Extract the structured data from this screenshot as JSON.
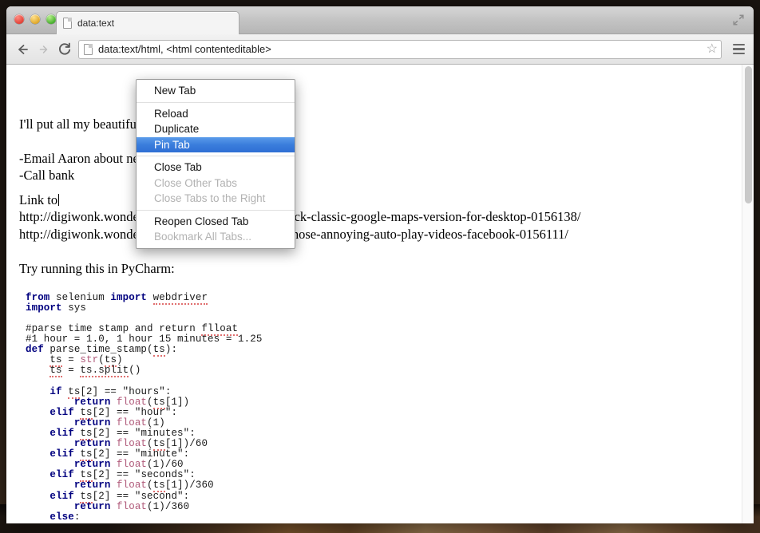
{
  "window": {
    "traffic_lights": [
      "close",
      "minimize",
      "maximize"
    ],
    "fullscreen_icon": "fullscreen-arrows-icon"
  },
  "tab": {
    "title": "data:text",
    "favicon": "page-icon"
  },
  "toolbar": {
    "back_icon": "arrow-left-icon",
    "forward_icon": "arrow-right-icon",
    "reload_icon": "reload-icon",
    "url_value": "data:text/html, <html contenteditable>",
    "url_visible_left": "data:",
    "url_visible_right": "able>",
    "bookmark_icon": "star-icon",
    "menu_icon": "hamburger-menu-icon"
  },
  "context_menu": {
    "groups": [
      {
        "items": [
          {
            "label": "New Tab",
            "state": "enabled"
          }
        ]
      },
      {
        "items": [
          {
            "label": "Reload",
            "state": "enabled"
          },
          {
            "label": "Duplicate",
            "state": "enabled"
          },
          {
            "label": "Pin Tab",
            "state": "selected"
          }
        ]
      },
      {
        "items": [
          {
            "label": "Close Tab",
            "state": "enabled"
          },
          {
            "label": "Close Other Tabs",
            "state": "disabled"
          },
          {
            "label": "Close Tabs to the Right",
            "state": "disabled"
          }
        ]
      },
      {
        "items": [
          {
            "label": "Reopen Closed Tab",
            "state": "enabled"
          },
          {
            "label": "Bookmark All Tabs...",
            "state": "disabled"
          }
        ]
      }
    ],
    "highlight_color": "#3a7ddc"
  },
  "content": {
    "line_notes": "I'll put all my beautiful                           e down!",
    "note_email": "-Email Aaron about ne",
    "note_call": "-Call bank",
    "link_label": "Link to",
    "url_1": "http://digiwonk.wonderhowto.com/how-to/revert-back-classic-google-maps-version-for-desktop-0156138/",
    "url_2": "http://digiwonk.wonderhowto.com/how-to/disable-those-annoying-auto-play-videos-facebook-0156111/",
    "pycharm_line": "Try running this in PyCharm:",
    "code": "from selenium import webdriver\nimport sys\n\n#parse time stamp and return flloat\n#1 hour = 1.0, 1 hour 15 minutes = 1.25\ndef parse_time_stamp(ts):\n    ts = str(ts)\n    ts = ts.split()\n\n    if ts[2] == \"hours\":\n        return float(ts[1])\n    elif ts[2] == \"hour\":\n        return float(1)\n    elif ts[2] == \"minutes\":\n        return float(ts[1])/60\n    elif ts[2] == \"minute\":\n        return float(1)/60\n    elif ts[2] == \"seconds\":\n        return float(ts[1])/360\n    elif ts[2] == \"second\":\n        return float(1)/360\n    else:"
  },
  "scrollbar": {
    "thumb_position": "top"
  }
}
